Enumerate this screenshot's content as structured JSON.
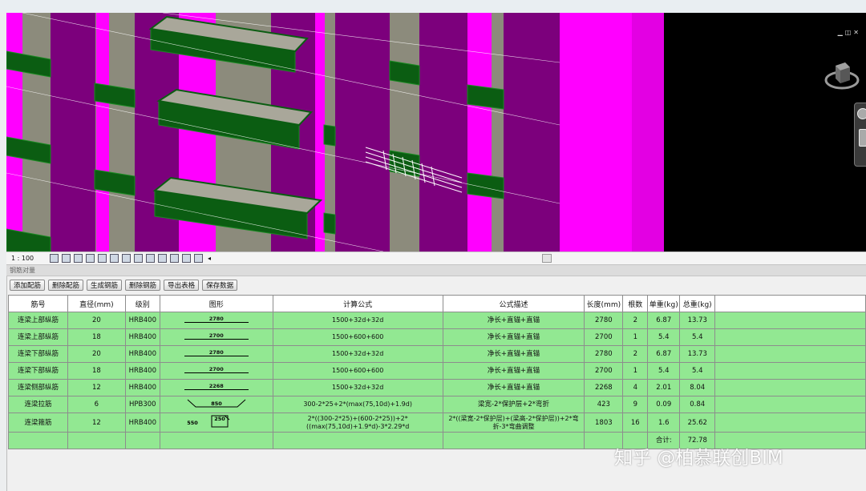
{
  "window": {
    "controls_icons": [
      "minimize-icon",
      "restore-icon",
      "close-icon"
    ]
  },
  "viewport": {
    "scale_label": "1 : 100",
    "colors": {
      "magenta": "#ff00ff",
      "purple": "#7c007c",
      "green": "#0b5d12",
      "slab": "#8c8b7c",
      "background": "#000000"
    },
    "icons": [
      "viewcube-icon",
      "navigation-wheel-icon",
      "zoom-icon"
    ]
  },
  "status_bar": {
    "icons": [
      "detail-level-icon",
      "visual-style-icon",
      "sun-path-icon",
      "shadows-icon",
      "crop-view-icon",
      "show-crop-icon",
      "unlock-3d-icon",
      "temporary-hide-icon",
      "reveal-hidden-icon",
      "analytical-model-icon",
      "highlight-icon",
      "constraints-icon",
      "pin-icon",
      "scroll-left-icon"
    ]
  },
  "panel": {
    "title": "钢筋对量"
  },
  "toolbar": {
    "buttons": [
      "添加配筋",
      "删除配筋",
      "生成钢筋",
      "删除钢筋",
      "导出表格",
      "保存数据"
    ]
  },
  "table": {
    "headers": [
      "筋号",
      "直径(mm)",
      "级别",
      "图形",
      "计算公式",
      "公式描述",
      "长度(mm)",
      "根数",
      "单重(kg)",
      "总重(kg)"
    ],
    "rows": [
      {
        "name": "连梁上部纵筋",
        "diameter": "20",
        "grade": "HRB400",
        "shape_label": "2780",
        "formula": "1500+32d+32d",
        "desc": "净长+直锚+直锚",
        "length": "2780",
        "count": "2",
        "unit_weight": "6.87",
        "total_weight": "13.73"
      },
      {
        "name": "连梁上部纵筋",
        "diameter": "18",
        "grade": "HRB400",
        "shape_label": "2700",
        "formula": "1500+600+600",
        "desc": "净长+直锚+直锚",
        "length": "2700",
        "count": "1",
        "unit_weight": "5.4",
        "total_weight": "5.4"
      },
      {
        "name": "连梁下部纵筋",
        "diameter": "20",
        "grade": "HRB400",
        "shape_label": "2780",
        "formula": "1500+32d+32d",
        "desc": "净长+直锚+直锚",
        "length": "2780",
        "count": "2",
        "unit_weight": "6.87",
        "total_weight": "13.73"
      },
      {
        "name": "连梁下部纵筋",
        "diameter": "18",
        "grade": "HRB400",
        "shape_label": "2700",
        "formula": "1500+600+600",
        "desc": "净长+直锚+直锚",
        "length": "2700",
        "count": "1",
        "unit_weight": "5.4",
        "total_weight": "5.4"
      },
      {
        "name": "连梁侧部纵筋",
        "diameter": "12",
        "grade": "HRB400",
        "shape_label": "2268",
        "formula": "1500+32d+32d",
        "desc": "净长+直锚+直锚",
        "length": "2268",
        "count": "4",
        "unit_weight": "2.01",
        "total_weight": "8.04"
      },
      {
        "name": "连梁拉筋",
        "diameter": "6",
        "grade": "HPB300",
        "shape_label": "850",
        "formula": "300-2*25+2*(max(75,10d)+1.9d)",
        "desc": "梁宽-2*保护层+2*弯折",
        "length": "423",
        "count": "9",
        "unit_weight": "0.09",
        "total_weight": "0.84"
      },
      {
        "name": "连梁箍筋",
        "diameter": "12",
        "grade": "HRB400",
        "shape_label_a": "550",
        "shape_label_b": "250",
        "formula": "2*((300-2*25)+(600-2*25))+2*((max(75,10d)+1.9*d)-3*2.29*d",
        "desc": "2*((梁宽-2*保护层)+(梁高-2*保护层))+2*弯折-3*弯曲调整",
        "length": "1803",
        "count": "16",
        "unit_weight": "1.6",
        "total_weight": "25.62"
      }
    ],
    "total_label": "合计:",
    "total_value": "72.78",
    "row_color": "#92e892"
  },
  "watermark": "知乎 @柏慕联创BIM"
}
